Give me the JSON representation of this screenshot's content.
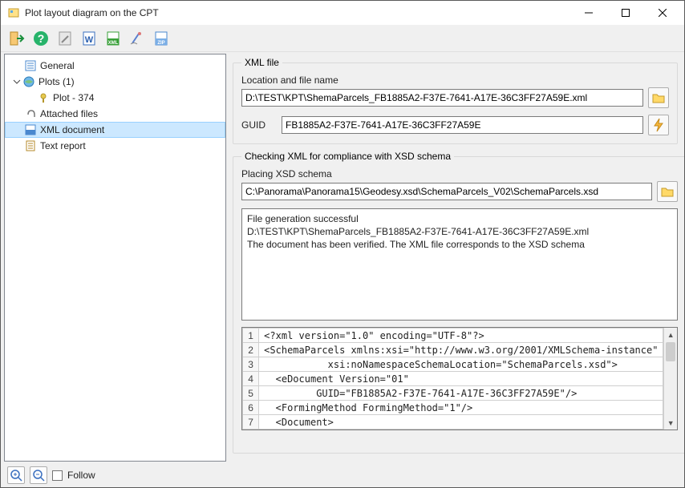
{
  "window": {
    "title": "Plot layout diagram on the CPT"
  },
  "tree": {
    "items": [
      {
        "label": "General"
      },
      {
        "label": "Plots (1)"
      },
      {
        "label": "Plot - 374"
      },
      {
        "label": "Attached files"
      },
      {
        "label": "XML document"
      },
      {
        "label": "Text report"
      }
    ]
  },
  "xmlfile": {
    "group_title": "XML file",
    "location_label": "Location and file name",
    "path": "D:\\TEST\\KPT\\ShemaParcels_FB1885A2-F37E-7641-A17E-36C3FF27A59E.xml",
    "guid_label": "GUID",
    "guid": "FB1885A2-F37E-7641-A17E-36C3FF27A59E"
  },
  "xsd": {
    "group_title": "Checking XML for compliance with XSD schema",
    "placing_label": "Placing XSD schema",
    "path": "C:\\Panorama\\Panorama15\\Geodesy.xsd\\SchemaParcels_V02\\SchemaParcels.xsd",
    "log": "File generation successful\nD:\\TEST\\KPT\\ShemaParcels_FB1885A2-F37E-7641-A17E-36C3FF27A59E.xml\nThe document has been verified. The XML file corresponds to the XSD schema"
  },
  "xml_lines": {
    "l1": "<?xml version=\"1.0\" encoding=\"UTF-8\"?>",
    "l2": "<SchemaParcels xmlns:xsi=\"http://www.w3.org/2001/XMLSchema-instance\"",
    "l3": "           xsi:noNamespaceSchemaLocation=\"SchemaParcels.xsd\">",
    "l4": "  <eDocument Version=\"01\"",
    "l5": "         GUID=\"FB1885A2-F37E-7641-A17E-36C3FF27A59E\"/>",
    "l6": "  <FormingMethod FormingMethod=\"1\"/>",
    "l7": "  <Document>"
  },
  "line_numbers": {
    "n1": "1",
    "n2": "2",
    "n3": "3",
    "n4": "4",
    "n5": "5",
    "n6": "6",
    "n7": "7"
  },
  "footer": {
    "follow_label": "Follow"
  }
}
